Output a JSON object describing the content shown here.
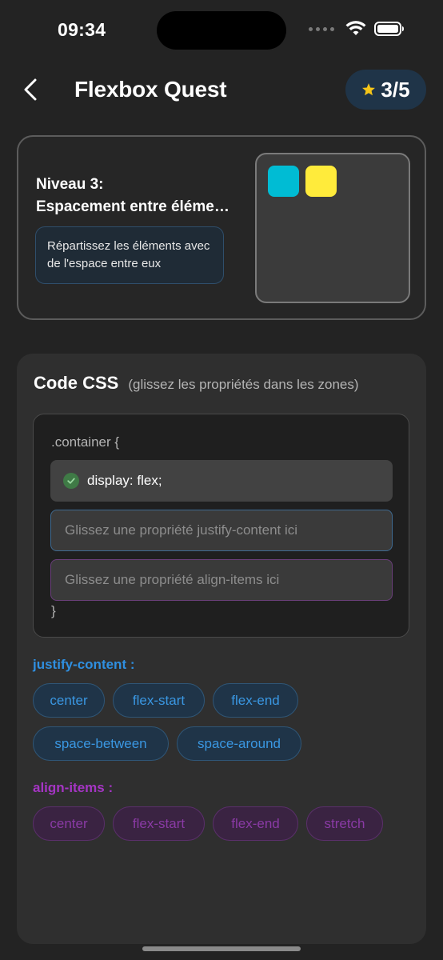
{
  "status_bar": {
    "time": "09:34"
  },
  "nav": {
    "title": "Flexbox Quest",
    "score": "3/5",
    "score_icon": "star-icon",
    "accent": "#f5c518"
  },
  "level": {
    "title_line1": "Niveau 3:",
    "title_line2": "Espacement entre éléments",
    "instruction": "Répartissez les éléments avec de l'espace entre eux",
    "preview_colors": [
      "#00bcd4",
      "#ffeb3b"
    ]
  },
  "code": {
    "title": "Code CSS",
    "hint": "(glissez les propriétés dans les zones)",
    "line_open": ".container {",
    "line_close": "}",
    "filled_slot": "display: flex;",
    "justify_placeholder": "Glissez une propriété justify-content ici",
    "align_placeholder": "Glissez une propriété align-items ici"
  },
  "justify_group": {
    "label": "justify-content :",
    "color": "#2f8fe0",
    "options": [
      "center",
      "flex-start",
      "flex-end",
      "space-between",
      "space-around"
    ]
  },
  "align_group": {
    "label": "align-items :",
    "color": "#a535c4",
    "options": [
      "center",
      "flex-start",
      "flex-end",
      "stretch"
    ]
  }
}
